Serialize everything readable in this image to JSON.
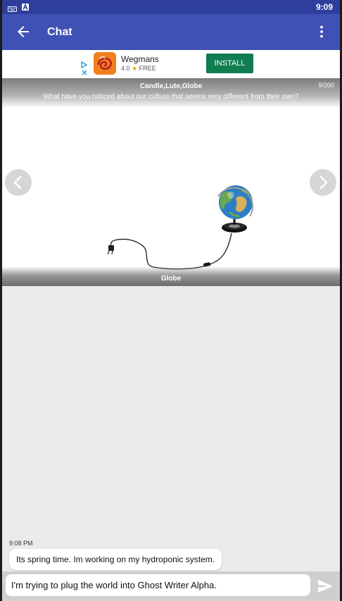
{
  "status_bar": {
    "time": "9:09",
    "icons": [
      "keyboard-icon",
      "a-icon"
    ]
  },
  "toolbar": {
    "title": "Chat",
    "back_icon": "arrow-back-icon",
    "menu_icon": "more-vert-icon"
  },
  "ad": {
    "app_name": "Wegmans",
    "rating": "4.0",
    "price": "FREE",
    "install_label": "INSTALL",
    "install_color": "#0f7d50"
  },
  "prompt_card": {
    "words": "Candle,Lute,Globe",
    "counter": "9/200",
    "question": "What have you noticed about our culture that seems very different from  their own?",
    "caption": "Globe"
  },
  "chat": {
    "timestamp": "9:08 PM",
    "message": "Its spring time.  Im working on my hydroponic system."
  },
  "composer": {
    "value": "I'm trying to plug the world into Ghost Writer Alpha.",
    "send_icon": "send-icon"
  },
  "colors": {
    "status_bar": "#2d3e9c",
    "toolbar": "#3f51b5",
    "background": "#ebebeb"
  }
}
